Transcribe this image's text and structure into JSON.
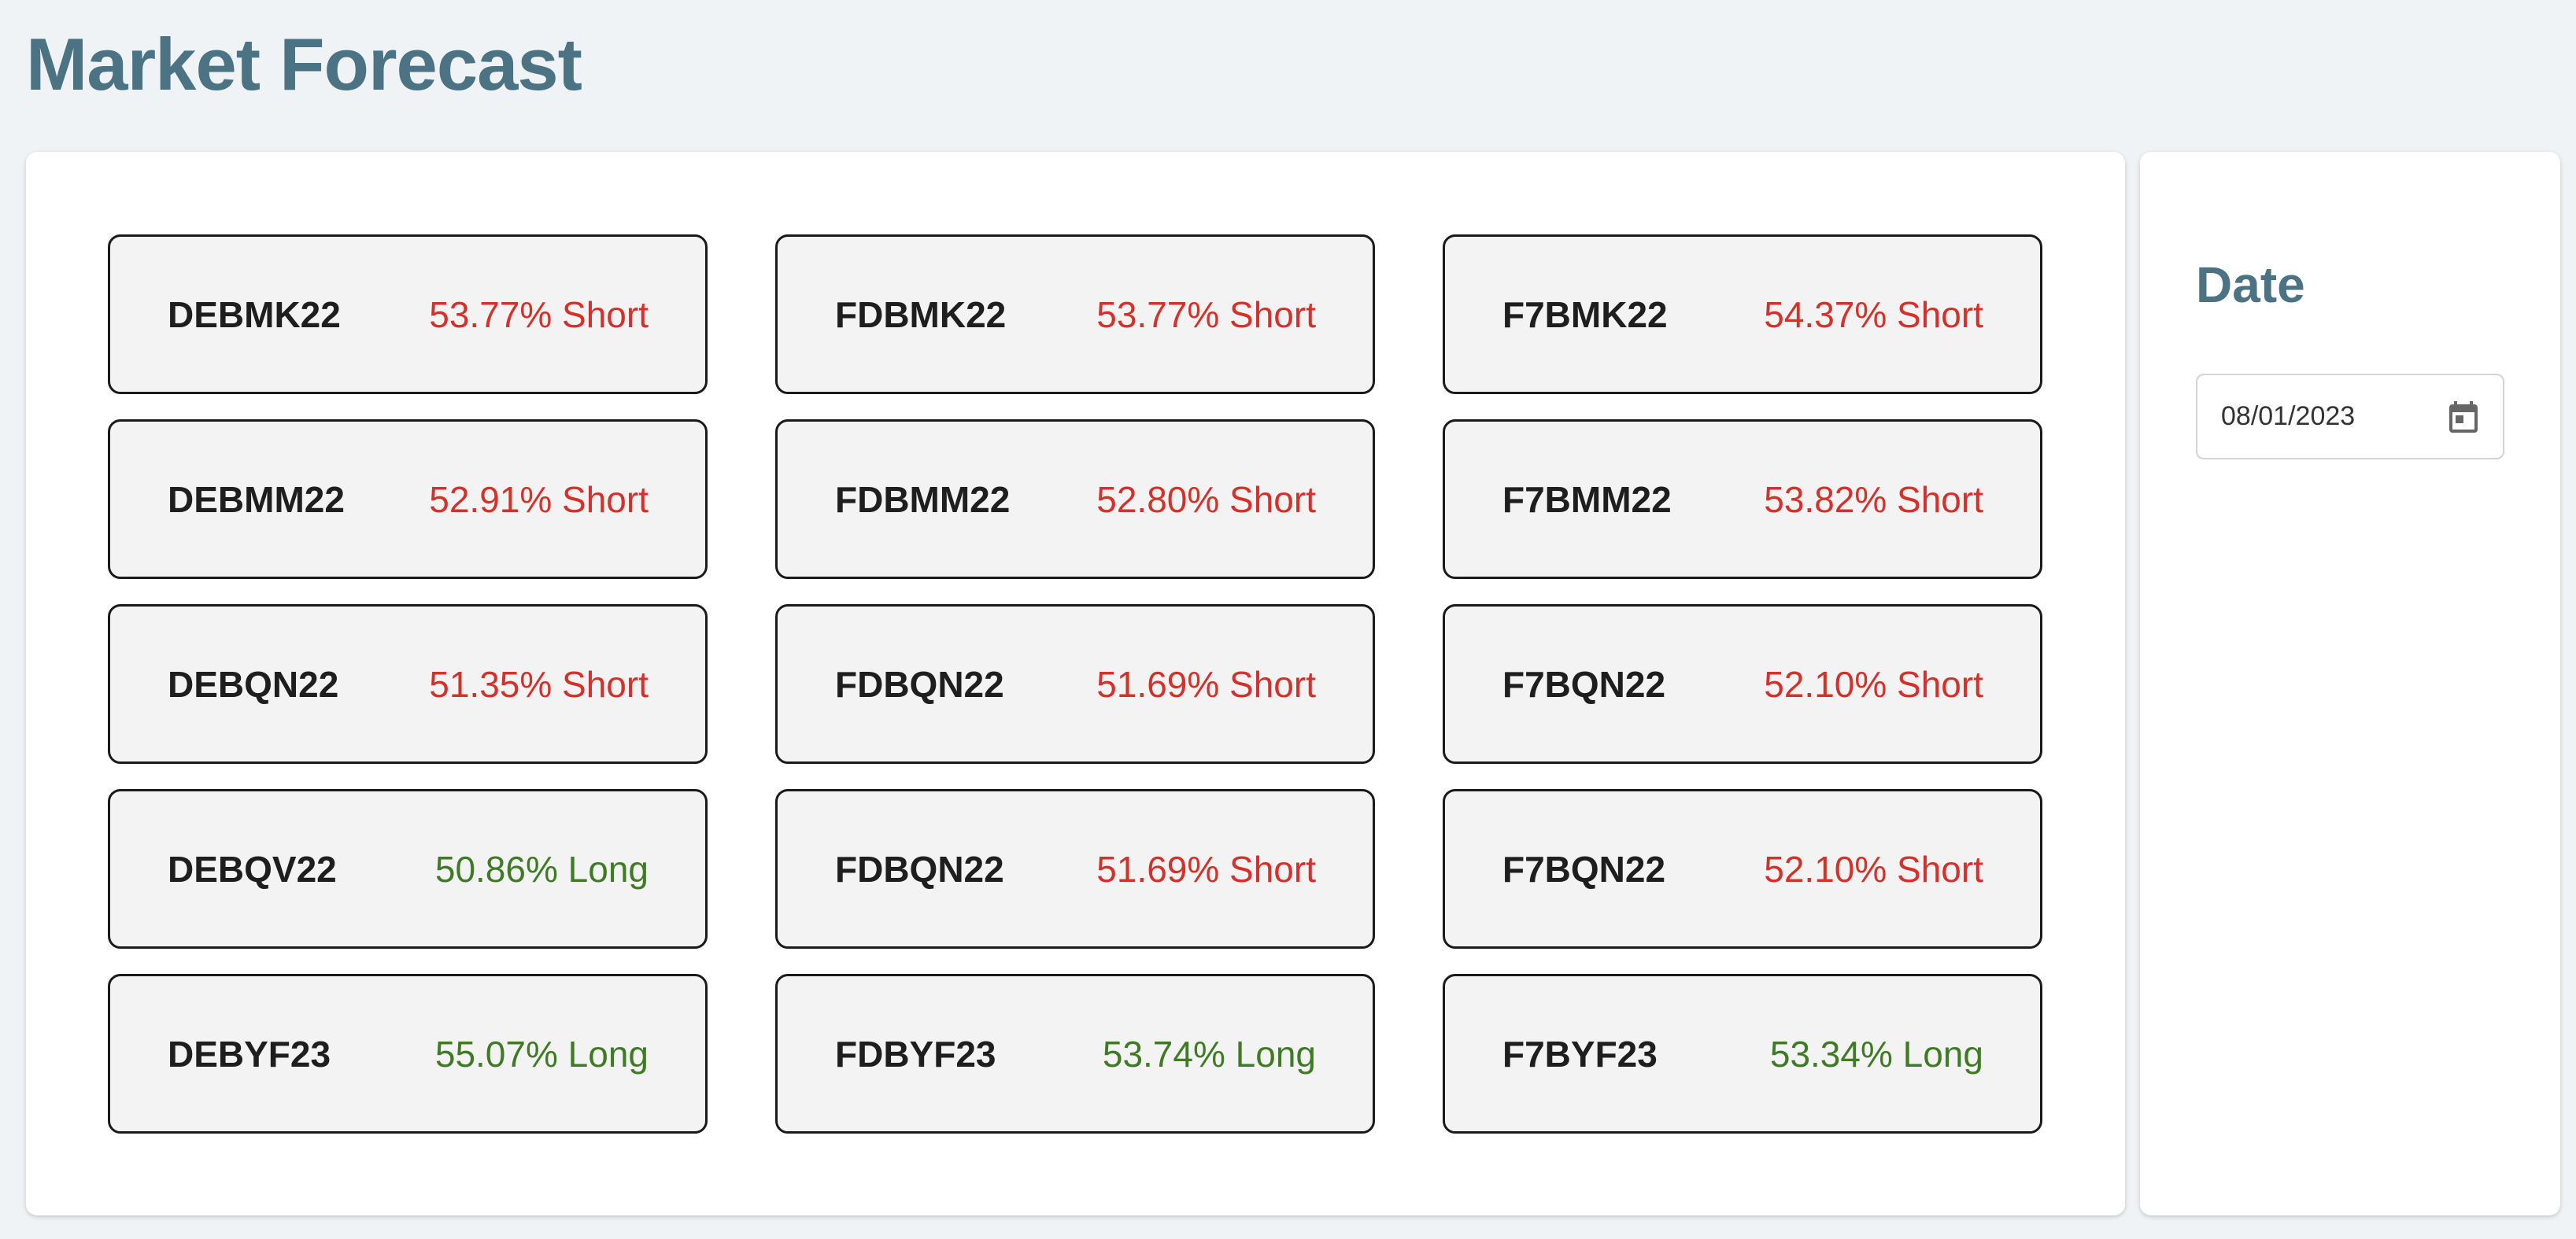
{
  "page": {
    "title": "Market Forecast"
  },
  "colors": {
    "title": "#4b7383",
    "short": "#d3312a",
    "long": "#3f7a24",
    "background": "#eff3f6"
  },
  "forecasts": [
    {
      "ticker": "DEBMK22",
      "signal": "53.77% Short",
      "direction": "short"
    },
    {
      "ticker": "FDBMK22",
      "signal": "53.77% Short",
      "direction": "short"
    },
    {
      "ticker": "F7BMK22",
      "signal": "54.37% Short",
      "direction": "short"
    },
    {
      "ticker": "DEBMM22",
      "signal": "52.91% Short",
      "direction": "short"
    },
    {
      "ticker": "FDBMM22",
      "signal": "52.80% Short",
      "direction": "short"
    },
    {
      "ticker": "F7BMM22",
      "signal": "53.82% Short",
      "direction": "short"
    },
    {
      "ticker": "DEBQN22",
      "signal": "51.35% Short",
      "direction": "short"
    },
    {
      "ticker": "FDBQN22",
      "signal": "51.69% Short",
      "direction": "short"
    },
    {
      "ticker": "F7BQN22",
      "signal": "52.10% Short",
      "direction": "short"
    },
    {
      "ticker": "DEBQV22",
      "signal": "50.86% Long",
      "direction": "long"
    },
    {
      "ticker": "FDBQN22",
      "signal": "51.69% Short",
      "direction": "short"
    },
    {
      "ticker": "F7BQN22",
      "signal": "52.10% Short",
      "direction": "short"
    },
    {
      "ticker": "DEBYF23",
      "signal": "55.07% Long",
      "direction": "long"
    },
    {
      "ticker": "FDBYF23",
      "signal": "53.74% Long",
      "direction": "long"
    },
    {
      "ticker": "F7BYF23",
      "signal": "53.34% Long",
      "direction": "long"
    }
  ],
  "date_panel": {
    "title": "Date",
    "value": "08/01/2023",
    "icon": "calendar-icon"
  }
}
